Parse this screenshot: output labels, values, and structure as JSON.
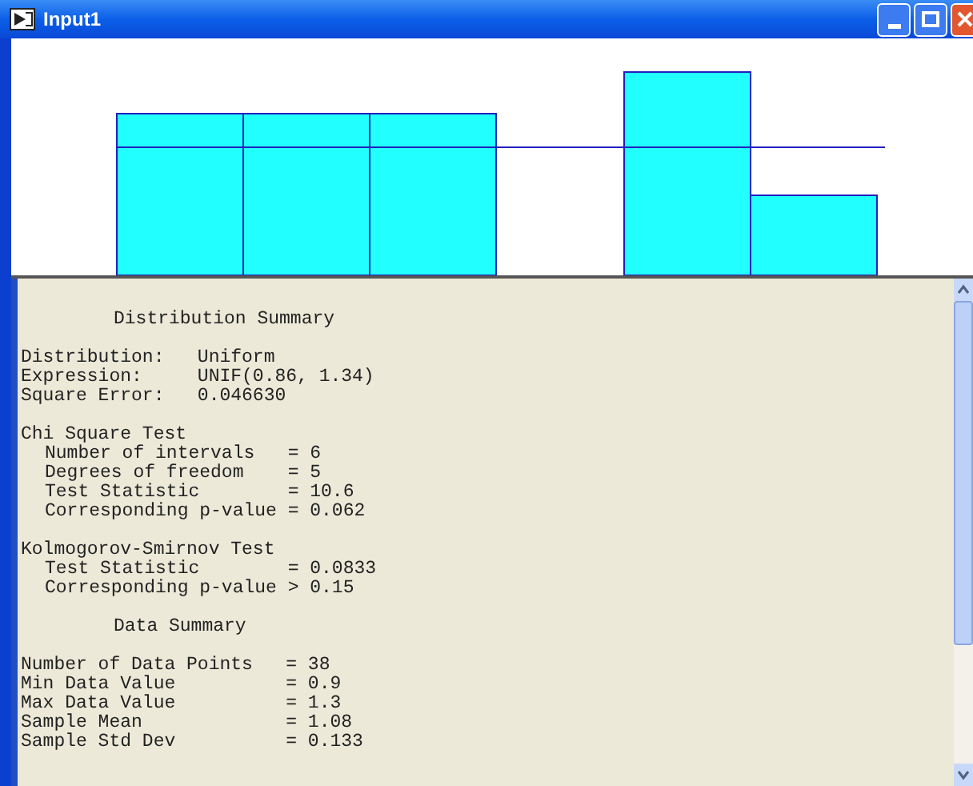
{
  "window": {
    "title": "Input1"
  },
  "report": {
    "sections": [
      {
        "kind": "heading",
        "lines": [
          "Distribution Summary"
        ]
      },
      {
        "kind": "block",
        "lines": [
          "Distribution:   Uniform",
          "Expression:     UNIF(0.86, 1.34)",
          "Square Error:   0.046630"
        ]
      },
      {
        "kind": "test",
        "title": "Chi Square Test",
        "lines": [
          "Number of intervals   = 6",
          "Degrees of freedom    = 5",
          "Test Statistic        = 10.6",
          "Corresponding p-value = 0.062"
        ]
      },
      {
        "kind": "test",
        "title": "Kolmogorov-Smirnov Test",
        "lines": [
          "Test Statistic        = 0.0833",
          "Corresponding p-value > 0.15"
        ]
      },
      {
        "kind": "heading",
        "lines": [
          "Data Summary"
        ]
      },
      {
        "kind": "block",
        "lines": [
          "Number of Data Points   = 38",
          "Min Data Value          = 0.9",
          "Max Data Value          = 1.3",
          "Sample Mean             = 1.08",
          "Sample Std Dev          = 0.133"
        ]
      }
    ]
  }
}
